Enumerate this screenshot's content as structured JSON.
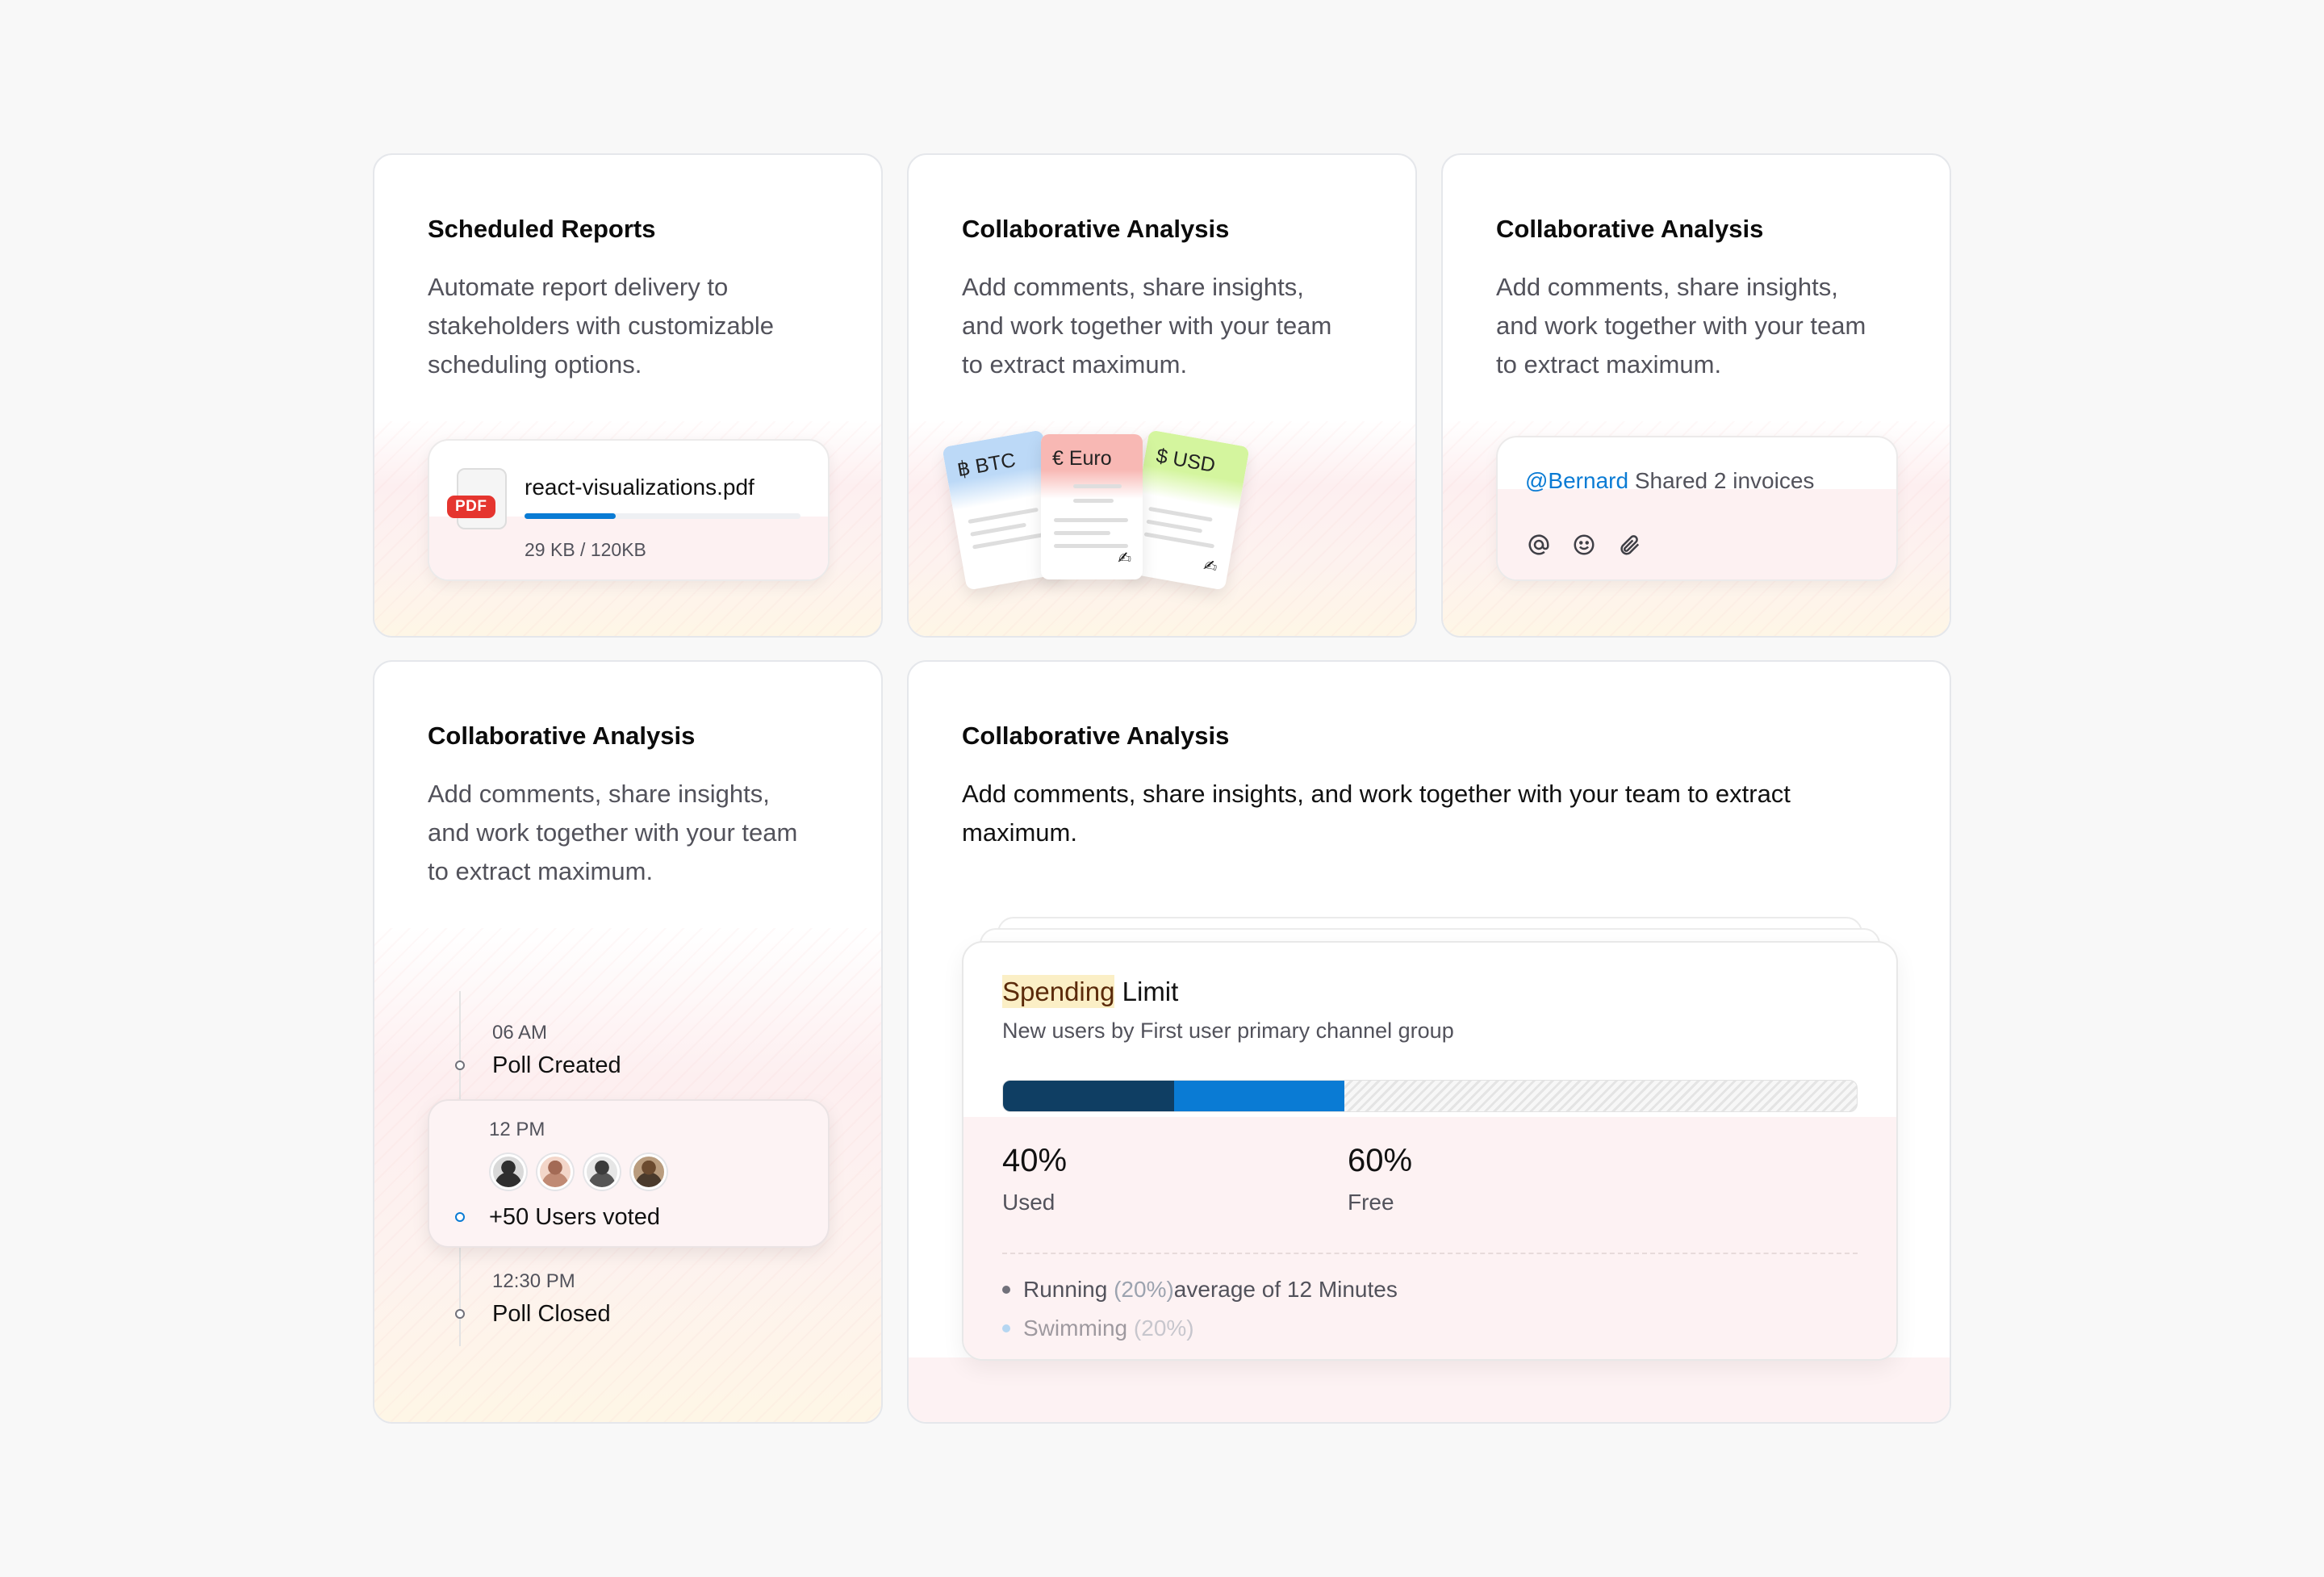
{
  "cards": {
    "scheduled": {
      "title": "Scheduled Reports",
      "desc_lines": [
        "Automate report delivery to",
        "stakeholders with customizable",
        "scheduling options."
      ],
      "file": {
        "badge": "PDF",
        "name": "react-visualizations.pdf",
        "size": "29 KB / 120KB",
        "progress_percent": 33,
        "accent": "#0a7bd4",
        "badge_color": "#e5352f"
      }
    },
    "currency": {
      "title": "Collaborative Analysis",
      "desc_lines": [
        "Add comments, share insights,",
        "and work together with your team",
        "to extract maximum."
      ],
      "papers": [
        {
          "label": "฿ BTC",
          "color": "#bcd9f7"
        },
        {
          "label": "€ Euro",
          "color": "#f8b8b4"
        },
        {
          "label": "$ USD",
          "color": "#d4f59e"
        }
      ],
      "signature_icon": "signature-icon"
    },
    "comment": {
      "title": "Collaborative Analysis",
      "desc_lines": [
        "Add comments, share insights,",
        "and work together with your team",
        "to extract maximum."
      ],
      "mention": "@Bernard",
      "message": " Shared 2 invoices",
      "icons": [
        "at-icon",
        "smiley-icon",
        "paperclip-icon"
      ]
    },
    "timeline": {
      "title": "Collaborative Analysis",
      "desc_lines": [
        "Add comments, share insights,",
        "and work together with your team",
        "to extract maximum."
      ],
      "events": [
        {
          "time": "06 AM",
          "label": "Poll Created"
        },
        {
          "time": "12 PM",
          "label": "+50 Users voted"
        },
        {
          "time": "12:30 PM",
          "label": "Poll Closed"
        }
      ],
      "avatar_count": 4
    },
    "spending": {
      "title": "Collaborative Analysis",
      "desc_lines": [
        "Add comments, share insights, and work together with your team to extract",
        "maximum."
      ],
      "widget": {
        "title_highlight": "Spending",
        "title_rest": " Limit",
        "subtitle": "New users by First user primary channel group",
        "bar": {
          "dark_percent": 20,
          "blue_percent": 20,
          "dark_color": "#0f3e63",
          "blue_color": "#0a7bd4"
        },
        "stats": [
          {
            "value": "40%",
            "label": "Used"
          },
          {
            "value": "60%",
            "label": "Free"
          }
        ],
        "legend": [
          {
            "name": "Running",
            "pct": "(20%)",
            "suffix": " average of 12 Minutes",
            "color": "#71717a"
          },
          {
            "name": "Swimming",
            "pct": "(20%)",
            "suffix": "",
            "color": "#7cc0f0"
          }
        ]
      }
    }
  }
}
